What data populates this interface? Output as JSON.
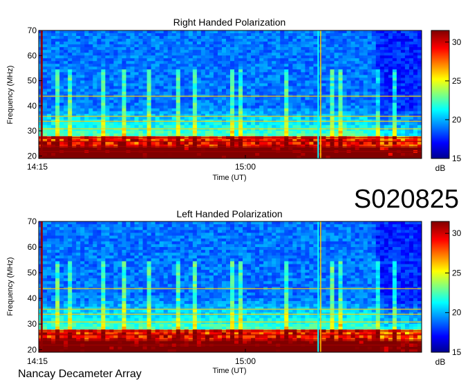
{
  "observation_id": "S020825",
  "footer": "Nancay Decameter Array",
  "colors": {
    "background_low": "#0a1fd8",
    "noise_mid": "#00b8ff",
    "strong": "#b00000",
    "colorbar_stops": [
      "#00008f",
      "#0000ff",
      "#00ffff",
      "#ffff00",
      "#ff0000",
      "#800000"
    ]
  },
  "chart_data": [
    {
      "type": "heatmap",
      "title": "Right Handed Polarization",
      "xlabel": "Time (UT)",
      "ylabel": "Frequency (MHz)",
      "x_ticks": [
        "14:15",
        "15:00"
      ],
      "y_ticks": [
        20,
        30,
        40,
        50,
        60,
        70
      ],
      "ylim": [
        19,
        70
      ],
      "colorbar": {
        "label": "dB",
        "ticks": [
          15,
          20,
          25,
          30
        ],
        "range": [
          15,
          31.5
        ]
      },
      "features": {
        "strong_emission_band_MHz": [
          20,
          28
        ],
        "vertical_interference_times": [
          "14:17",
          "15:22",
          "15:23"
        ]
      }
    },
    {
      "type": "heatmap",
      "title": "Left Handed Polarization",
      "xlabel": "Time (UT)",
      "ylabel": "Frequency (MHz)",
      "x_ticks": [
        "14:15",
        "15:00"
      ],
      "y_ticks": [
        20,
        30,
        40,
        50,
        60,
        70
      ],
      "ylim": [
        19,
        70
      ],
      "colorbar": {
        "label": "dB",
        "ticks": [
          15,
          20,
          25,
          30
        ],
        "range": [
          15,
          31.5
        ]
      },
      "features": {
        "strong_emission_band_MHz": [
          20,
          28
        ],
        "vertical_interference_times": [
          "14:17",
          "15:22",
          "15:23"
        ]
      }
    }
  ]
}
